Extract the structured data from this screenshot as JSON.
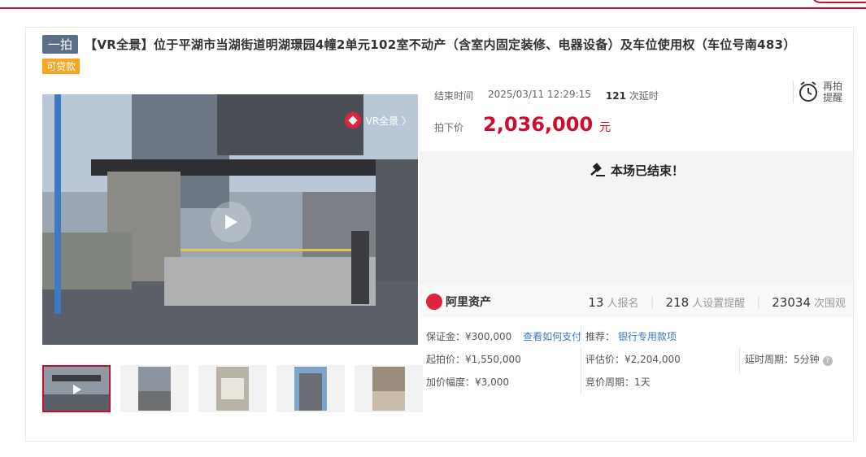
{
  "header": {
    "badge": "一拍",
    "title": "【VR全景】位于平湖市当湖街道明湖璟园4幢2单元102室不动产（含室内固定装修、电器设备）及车位使用权（车位号南483）",
    "loan_tag": "可贷款"
  },
  "media": {
    "vr_label": "VR全景 〉",
    "thumbnail_count": 5
  },
  "auction": {
    "end_label": "结束时间",
    "end_time": "2025/03/11 12:29:15",
    "delay_count": "121",
    "delay_suffix": "次延时",
    "remind_label": "再拍提醒",
    "price_label": "拍下价",
    "price": "2,036,000",
    "currency": "元",
    "ended_text": "本场已结束！"
  },
  "stats": {
    "platform": "阿里资产",
    "signups": "13",
    "signups_label": "人报名",
    "reminders": "218",
    "reminders_label": "人设置提醒",
    "views": "23034",
    "views_label": "次围观"
  },
  "details": {
    "deposit_label": "保证金：",
    "deposit": "¥300,000",
    "how_to_pay": "查看如何支付",
    "recommend_label": "推荐：",
    "recommend_link": "银行专用款项",
    "start_price_label": "起拍价：",
    "start_price": "¥1,550,000",
    "appraisal_label": "评估价：",
    "appraisal": "¥2,204,000",
    "delay_period_label": "延时周期：",
    "delay_period": "5分钟",
    "increment_label": "加价幅度：",
    "increment": "¥3,000",
    "bid_period_label": "竞价周期：",
    "bid_period": "1天"
  },
  "colors": {
    "accent": "#c8102e",
    "link": "#3b78c0",
    "tag": "#f5a623",
    "badge": "#5c6e8a"
  }
}
